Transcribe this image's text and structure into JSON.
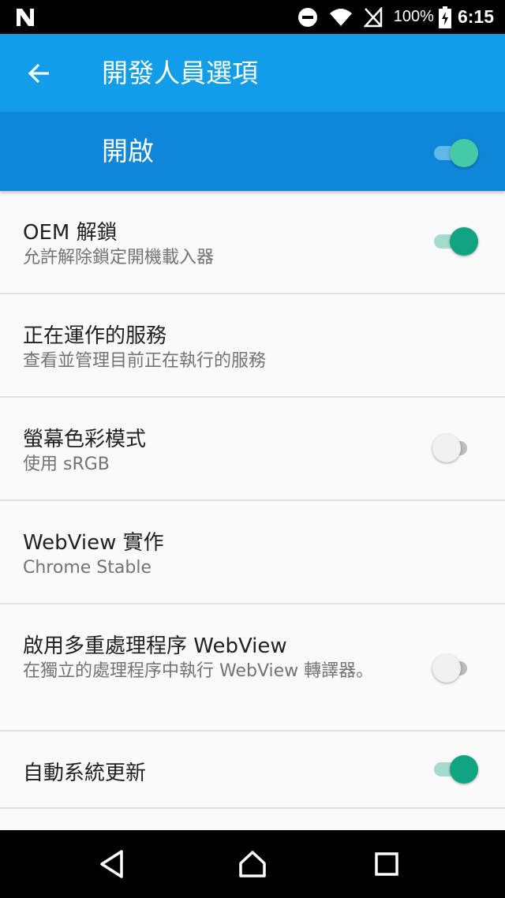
{
  "status_bar": {
    "battery_text": "100%",
    "time": "6:15"
  },
  "app_bar": {
    "title": "開發人員選項"
  },
  "master_switch": {
    "label": "開啟",
    "checked": true
  },
  "settings": [
    {
      "title": "OEM 解鎖",
      "summary": "允許解除鎖定開機載入器",
      "switch": "on"
    },
    {
      "title": "正在運作的服務",
      "summary": "查看並管理目前正在執行的服務",
      "switch": "none"
    },
    {
      "title": "螢幕色彩模式",
      "summary": "使用 sRGB",
      "switch": "off"
    },
    {
      "title": "WebView 實作",
      "summary": "Chrome Stable",
      "switch": "none"
    },
    {
      "title": "啟用多重處理程序 WebView",
      "summary": "在獨立的處理程序中執行 WebView 轉譯器。",
      "switch": "off"
    },
    {
      "title": "自動系統更新",
      "summary": "",
      "switch": "on"
    }
  ],
  "colors": {
    "app_bar": "#129de9",
    "master_bar": "#0f86d8",
    "switch_on_thumb": "#0fa582",
    "switch_on_track": "#a6dccd"
  }
}
